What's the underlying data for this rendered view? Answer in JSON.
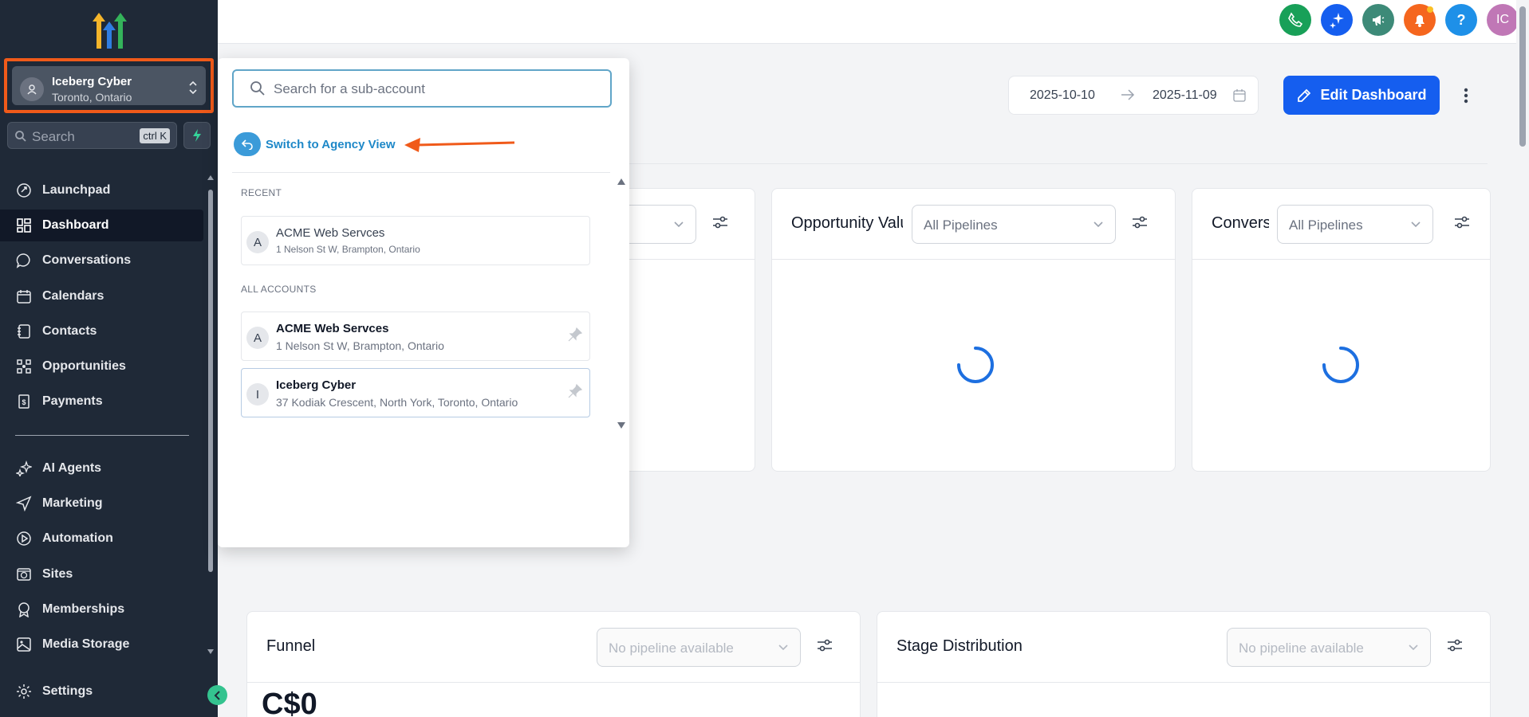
{
  "account_switcher": {
    "name": "Iceberg Cyber",
    "location": "Toronto, Ontario"
  },
  "sidebar_search": {
    "placeholder": "Search",
    "shortcut": "ctrl K"
  },
  "nav": {
    "launchpad": "Launchpad",
    "dashboard": "Dashboard",
    "conversations": "Conversations",
    "calendars": "Calendars",
    "contacts": "Contacts",
    "opportunities": "Opportunities",
    "payments": "Payments",
    "ai_agents": "AI Agents",
    "marketing": "Marketing",
    "automation": "Automation",
    "sites": "Sites",
    "memberships": "Memberships",
    "media_storage": "Media Storage",
    "settings": "Settings"
  },
  "topbar": {
    "avatar_initials": "IC",
    "help_label": "?",
    "colors": {
      "phone": "#18a058",
      "ai": "#155eef",
      "announce": "#3d8a78",
      "bell": "#f5661e",
      "help": "#1e90e8",
      "avatar": "#c077b6"
    }
  },
  "dashboard": {
    "date_start": "2025-10-10",
    "date_end": "2025-11-09",
    "edit_button": "Edit Dashboard",
    "accent_color": "#155eef"
  },
  "widgets": {
    "opportunity_title": "Opportunity Value",
    "opportunity_select": "All Pipelines",
    "conversion_title": "Conversion Rate",
    "conversion_select": "All Pipelines",
    "funnel_title": "Funnel",
    "funnel_select": "No pipeline available",
    "funnel_value": "C$0",
    "stage_title": "Stage Distribution",
    "stage_select": "No pipeline available"
  },
  "dropdown": {
    "search_placeholder": "Search for a sub-account",
    "agency_link": "Switch to Agency View",
    "recent_label": "RECENT",
    "all_label": "ALL ACCOUNTS",
    "recent": [
      {
        "initial": "A",
        "name": "ACME Web Servces",
        "address": "1 Nelson St W, Brampton, Ontario"
      }
    ],
    "all": [
      {
        "initial": "A",
        "name": "ACME Web Servces",
        "address": "1 Nelson St W, Brampton, Ontario"
      },
      {
        "initial": "I",
        "name": "Iceberg Cyber",
        "address": "37 Kodiak Crescent, North York, Toronto, Ontario"
      }
    ]
  }
}
